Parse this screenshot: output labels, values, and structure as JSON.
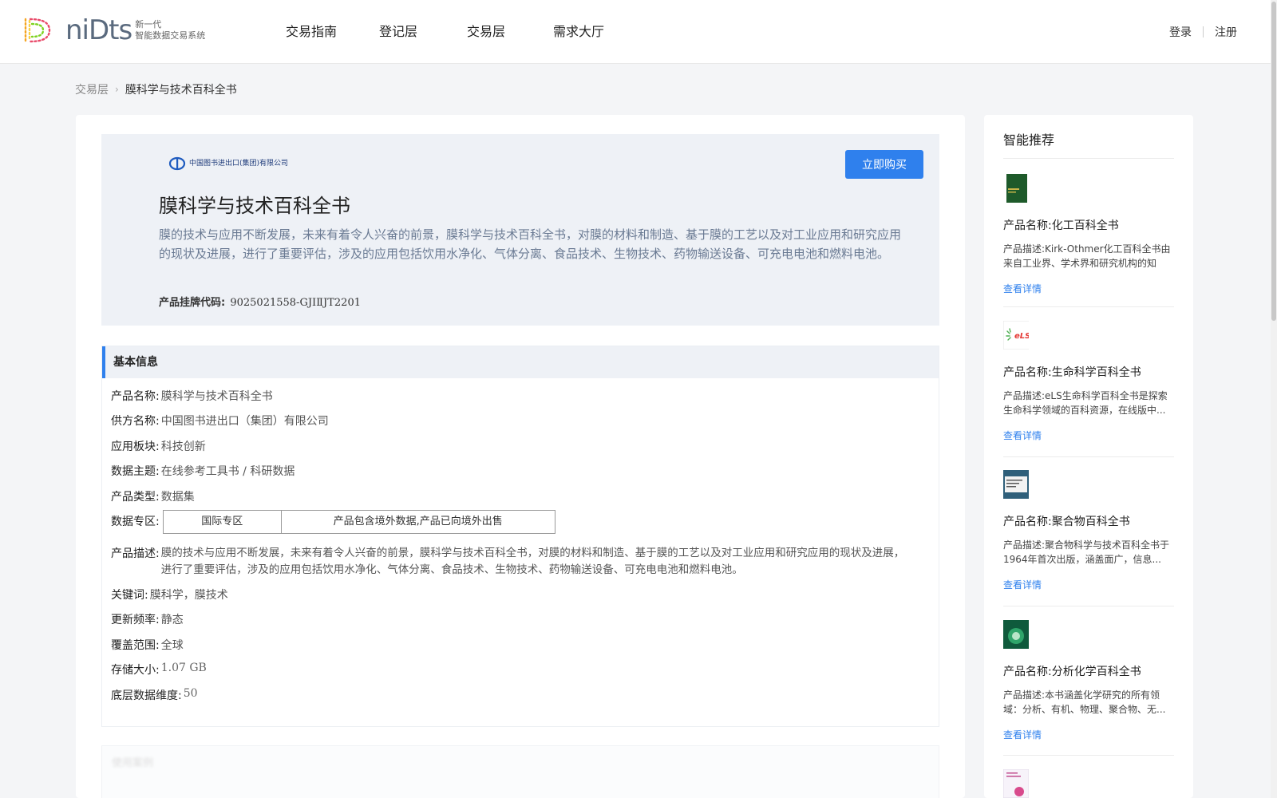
{
  "header": {
    "brand": "niDts",
    "brand_sub_1": "新一代",
    "brand_sub_2": "智能数据交易系统",
    "nav": [
      "交易指南",
      "登记层",
      "交易层",
      "需求大厅"
    ],
    "login": "登录",
    "register": "注册"
  },
  "breadcrumb": {
    "parent": "交易层",
    "current": "膜科学与技术百科全书"
  },
  "hero": {
    "supplier_logo_text": "中国图书进出口(集团)有限公司",
    "buy_label": "立即购买",
    "title": "膜科学与技术百科全书",
    "description": "膜的技术与应用不断发展，未来有着令人兴奋的前景，膜科学与技术百科全书，对膜的材料和制造、基于膜的工艺以及对工业应用和研究应用的现状及进展，进行了重要评估，涉及的应用包括饮用水净化、气体分离、食品技术、生物技术、药物输送设备、可充电电池和燃料电池。",
    "code_label": "产品挂牌代码:",
    "code_value": "9025021558-GJIⅡJT2201"
  },
  "basic_info": {
    "heading": "基本信息",
    "product_name_label": "产品名称:",
    "product_name": "膜科学与技术百科全书",
    "supplier_label": "供方名称:",
    "supplier": "中国图书进出口（集团）有限公司",
    "sector_label": "应用板块:",
    "sector": "科技创新",
    "topic_label": "数据主题:",
    "topic": "在线参考工具书 / 科研数据",
    "type_label": "产品类型:",
    "type": "数据集",
    "zone_label": "数据专区:",
    "zone": "国际专区",
    "zone_note": "产品包含境外数据,产品已向境外出售",
    "desc_label": "产品描述:",
    "desc": "膜的技术与应用不断发展，未来有着令人兴奋的前景，膜科学与技术百科全书，对膜的材料和制造、基于膜的工艺以及对工业应用和研究应用的现状及进展，进行了重要评估，涉及的应用包括饮用水净化、气体分离、食品技术、生物技术、药物输送设备、可充电电池和燃料电池。",
    "keywords_label": "关键词:",
    "keywords": "膜科学，膜技术",
    "frequency_label": "更新频率:",
    "frequency": "静态",
    "coverage_label": "覆盖范围:",
    "coverage": "全球",
    "size_label": "存储大小:",
    "size": "1.07 GB",
    "dimension_label": "底层数据维度:",
    "dimension": "50"
  },
  "section2_heading": "使用案例",
  "sidebar": {
    "title": "智能推荐",
    "name_prefix": "产品名称:",
    "desc_prefix": "产品描述:",
    "more_label": "查看详情",
    "items": [
      {
        "name": "化工百科全书",
        "desc": "Kirk-Othmer化工百科全书由来自工业界、学术界和研究机构的知识..."
      },
      {
        "name": "生命科学百科全书",
        "desc": "eLS生命科学百科全书是探索生命科学领域的百科资源，在线版中..."
      },
      {
        "name": "聚合物百科全书",
        "desc": "聚合物科学与技术百科全书于1964年首次出版，涵盖面广，信息..."
      },
      {
        "name": "分析化学百科全书",
        "desc": "本书涵盖化学研究的所有领域：分析、有机、物理、聚合物、无..."
      }
    ]
  },
  "colors": {
    "accent": "#2f80ed",
    "hero_bg": "#eef1f6",
    "page_bg": "#f4f5f7"
  }
}
